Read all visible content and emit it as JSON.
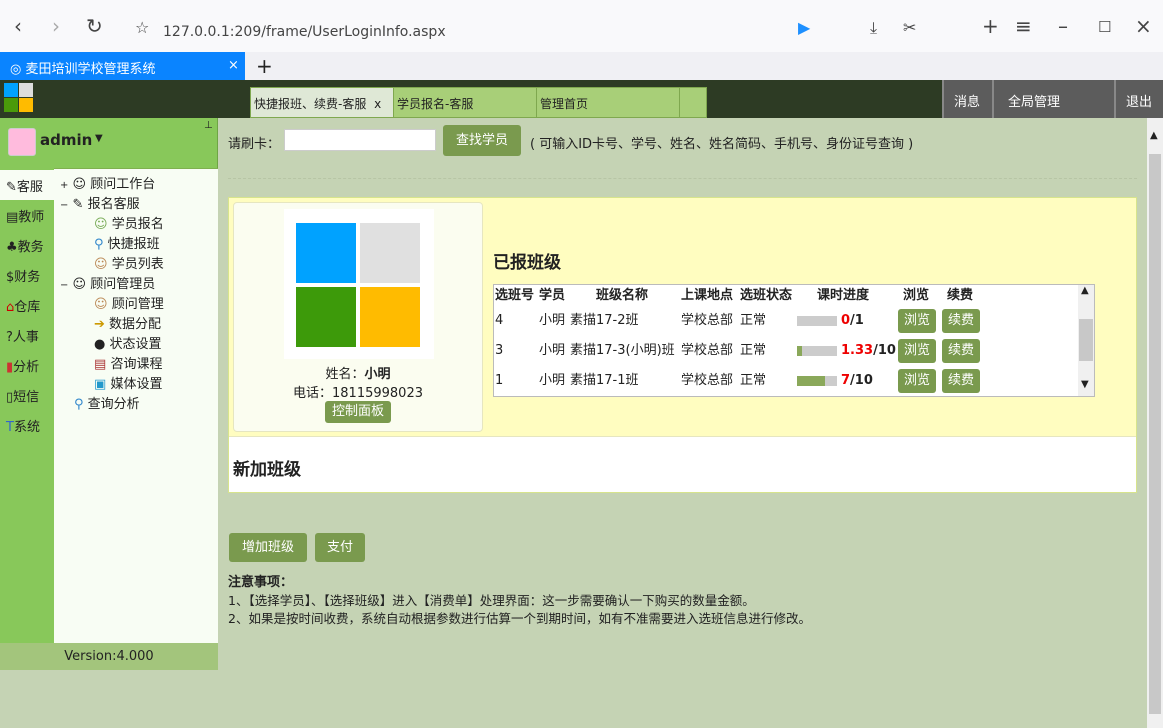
{
  "browser": {
    "url": "127.0.0.1:209/frame/UserLoginInfo.aspx",
    "tab_title": "麦田培训学校管理系统",
    "close": "×",
    "new_tab": "+"
  },
  "app": {
    "tabs": [
      {
        "label": "快捷报班、续费-客服",
        "close": "x"
      },
      {
        "label": "学员报名-客服"
      },
      {
        "label": "管理首页"
      }
    ],
    "right_buttons": [
      "消息",
      "全局管理",
      "退出"
    ]
  },
  "user": {
    "name": "admin"
  },
  "modules": [
    "客服",
    "教师",
    "教务",
    "财务",
    "仓库",
    "人事",
    "分析",
    "短信",
    "系统"
  ],
  "tree": [
    {
      "label": "顾问工作台",
      "toggle": "+"
    },
    {
      "label": "报名客服",
      "toggle": "−"
    },
    {
      "label": "学员报名"
    },
    {
      "label": "快捷报班"
    },
    {
      "label": "学员列表"
    },
    {
      "label": "顾问管理员",
      "toggle": "−"
    },
    {
      "label": "顾问管理"
    },
    {
      "label": "数据分配"
    },
    {
      "label": "状态设置"
    },
    {
      "label": "咨询课程"
    },
    {
      "label": "媒体设置"
    },
    {
      "label": "查询分析"
    }
  ],
  "version": "Version:4.000",
  "search": {
    "label": "请刷卡：",
    "value": "",
    "button": "查找学员",
    "hint": "( 可输入ID卡号、学号、姓名、姓名简码、手机号、身份证号查询 )"
  },
  "student": {
    "name_label": "姓名：",
    "name": "小明",
    "phone_label": "电话：",
    "phone": "18115998023",
    "control_panel": "控制面板"
  },
  "enrolled": {
    "title": "已报班级",
    "headers": [
      "选班号",
      "学员",
      "班级名称",
      "上课地点",
      "选班状态",
      "课时进度",
      "浏览",
      "续费"
    ],
    "rows": [
      {
        "id": "4",
        "student": "小明",
        "class": "素描17-2班",
        "location": "学校总部",
        "status": "正常",
        "done": "0",
        "total": "/1",
        "progress": 0,
        "browse": "浏览",
        "renew": "续费"
      },
      {
        "id": "3",
        "student": "小明",
        "class": "素描17-3(小明)班",
        "location": "学校总部",
        "status": "正常",
        "done": "1.33",
        "total": "/10",
        "progress": 0.133,
        "browse": "浏览",
        "renew": "续费"
      },
      {
        "id": "1",
        "student": "小明",
        "class": "素描17-1班",
        "location": "学校总部",
        "status": "正常",
        "done": "7",
        "total": "/10",
        "progress": 0.7,
        "browse": "浏览",
        "renew": "续费"
      }
    ]
  },
  "new_class": {
    "title": "新加班级"
  },
  "actions": {
    "add_class": "增加班级",
    "pay": "支付"
  },
  "notes": {
    "title": "注意事项：",
    "lines": [
      "1、【选择学员】、【选择班级】进入【消费单】处理界面：这一步需要确认一下购买的数量金额。",
      "2、如果是按时间收费，系统自动根据参数进行估算一个到期时间，如有不准需要进入选班信息进行修改。"
    ]
  }
}
